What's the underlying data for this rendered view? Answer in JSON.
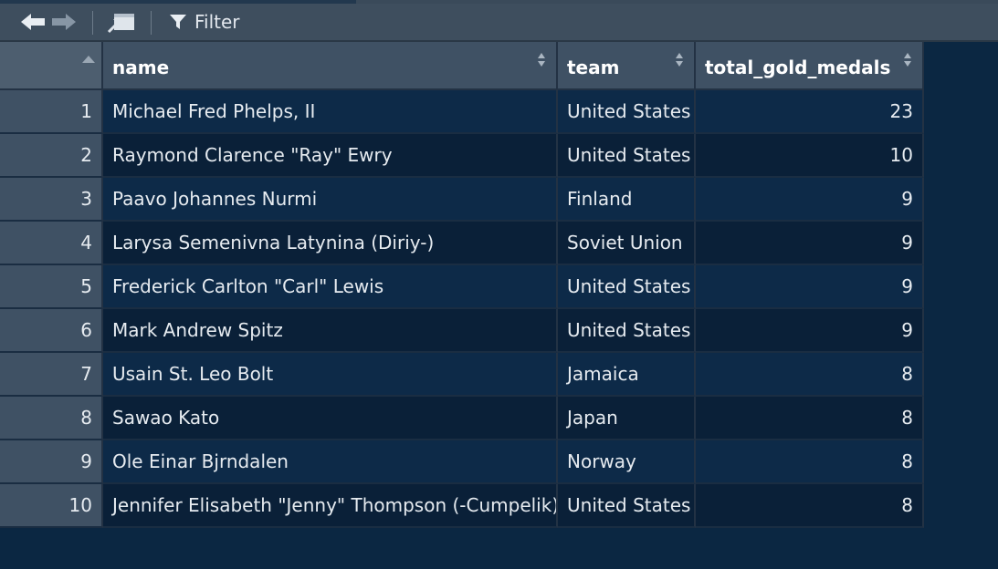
{
  "toolbar": {
    "back_icon": "arrow-left-icon",
    "forward_icon": "arrow-right-icon",
    "popout_icon": "popout-window-icon",
    "filter_icon": "funnel-icon",
    "filter_label": "Filter"
  },
  "table": {
    "columns": [
      "name",
      "team",
      "total_gold_medals"
    ],
    "rows": [
      {
        "index": "1",
        "name": "Michael Fred Phelps, II",
        "team": "United States",
        "total_gold_medals": "23"
      },
      {
        "index": "2",
        "name": "Raymond Clarence \"Ray\" Ewry",
        "team": "United States",
        "total_gold_medals": "10"
      },
      {
        "index": "3",
        "name": "Paavo Johannes Nurmi",
        "team": "Finland",
        "total_gold_medals": "9"
      },
      {
        "index": "4",
        "name": "Larysa Semenivna Latynina (Diriy-)",
        "team": "Soviet Union",
        "total_gold_medals": "9"
      },
      {
        "index": "5",
        "name": "Frederick Carlton \"Carl\" Lewis",
        "team": "United States",
        "total_gold_medals": "9"
      },
      {
        "index": "6",
        "name": "Mark Andrew Spitz",
        "team": "United States",
        "total_gold_medals": "9"
      },
      {
        "index": "7",
        "name": "Usain St. Leo Bolt",
        "team": "Jamaica",
        "total_gold_medals": "8"
      },
      {
        "index": "8",
        "name": "Sawao Kato",
        "team": "Japan",
        "total_gold_medals": "8"
      },
      {
        "index": "9",
        "name": "Ole Einar Bjrndalen",
        "team": "Norway",
        "total_gold_medals": "8"
      },
      {
        "index": "10",
        "name": "Jennifer Elisabeth \"Jenny\" Thompson (-Cumpelik)",
        "team": "United States",
        "total_gold_medals": "8"
      }
    ]
  },
  "colors": {
    "background": "#0b2742",
    "header": "#3f5164",
    "row_odd": "#0d2a48",
    "row_even": "#0a2038",
    "text": "#e6ebf0"
  }
}
